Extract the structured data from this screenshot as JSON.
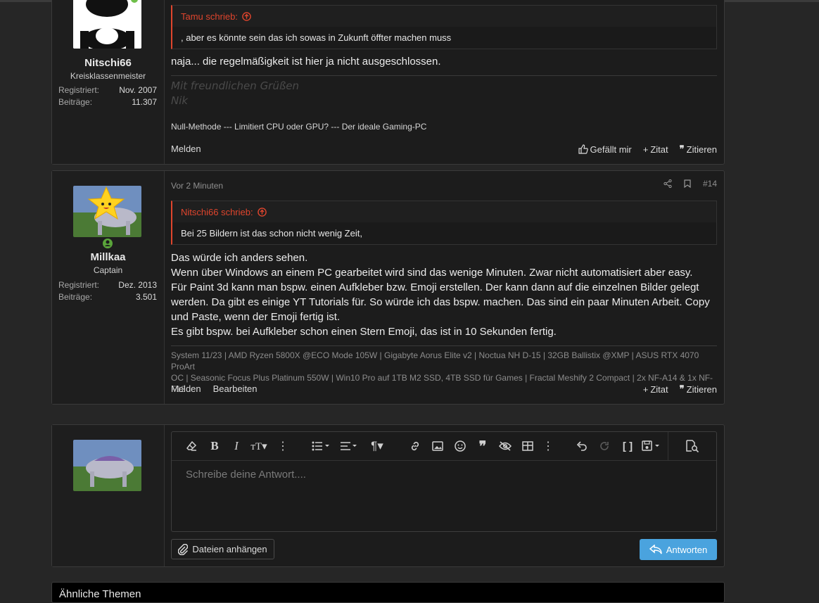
{
  "post1": {
    "user": {
      "name": "Nitschi66",
      "title": "Kreisklassenmeister",
      "registered_label": "Registriert:",
      "registered_value": "Nov. 2007",
      "posts_label": "Beiträge:",
      "posts_value": "11.307"
    },
    "quote": {
      "author": "Tamu schrieb:",
      "text": ", aber es könnte sein das ich sowas in Zukunft öffter machen muss"
    },
    "message": "naja... die regelmäßigkeit ist hier ja nicht ausgeschlossen.",
    "signature": {
      "line1": "Mit freundlichen Grüßen",
      "line2": "Nik",
      "links": "Null-Methode --- Limitiert CPU oder GPU? --- Der ideale Gaming-PC"
    },
    "actions": {
      "report": "Melden",
      "like": "Gefällt mir",
      "quick_quote": "Zitat",
      "quote": "Zitieren"
    }
  },
  "post2": {
    "time": "Vor 2 Minuten",
    "number": "#14",
    "user": {
      "name": "Millkaa",
      "title": "Captain",
      "registered_label": "Registriert:",
      "registered_value": "Dez. 2013",
      "posts_label": "Beiträge:",
      "posts_value": "3.501"
    },
    "quote": {
      "author": "Nitschi66 schrieb:",
      "text": "Bei 25 Bildern ist das schon nicht wenig Zeit,"
    },
    "message_lines": [
      "Das würde ich anders sehen.",
      "Wenn über Windows an einem PC gearbeitet wird sind das wenige Minuten. Zwar nicht automatisiert aber easy.",
      "Für Paint 3d kann man bspw. einen Aufkleber bzw. Emoji erstellen. Der kann dann auf die einzelnen Bilder gelegt",
      "werden. Da gibt es einige YT Tutorials für. So würde ich das bspw. machen. Das sind ein paar Minuten Arbeit. Copy",
      "und Paste, wenn der Emoji fertig ist.",
      "Es gibt bspw. bei Aufkleber schon einen Stern Emoji, das ist in 10 Sekunden fertig."
    ],
    "signature_lines": [
      "System 11/23 | AMD Ryzen 5800X @ECO Mode 105W | Gigabyte Aorus Elite v2 | Noctua NH D-15 | 32GB Ballistix @XMP | ASUS RTX 4070 ProArt",
      "OC | Seasonic Focus Plus Platinum 550W | Win10 Pro auf 1TB M2 SSD, 4TB SSD für Games | Fractal Meshify 2 Compact | 2x NF-A14 & 1x NF-F12"
    ],
    "actions": {
      "report": "Melden",
      "edit": "Bearbeiten",
      "quick_quote": "Zitat",
      "quote": "Zitieren"
    }
  },
  "editor": {
    "placeholder": "Schreibe deine Antwort....",
    "attach_label": "Dateien anhängen",
    "reply_label": "Antworten"
  },
  "similar": {
    "title": "Ähnliche Themen"
  },
  "colors": {
    "quote_accent": "#e0452d",
    "reply_button": "#4aa3de",
    "online": "#5aa53a"
  }
}
